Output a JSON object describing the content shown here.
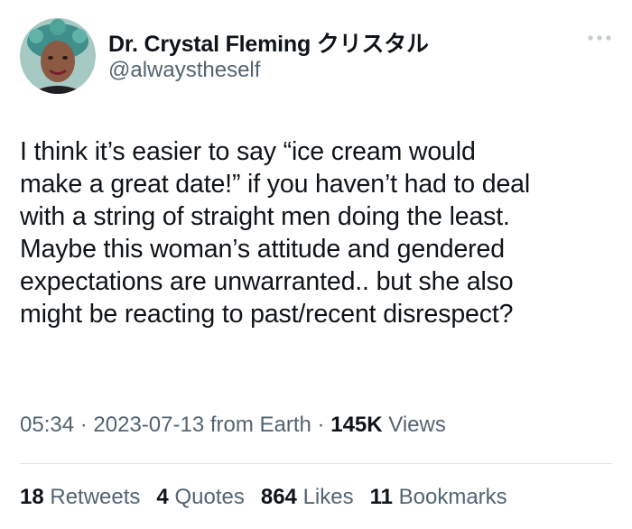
{
  "author": {
    "name": "Dr. Crystal Fleming クリスタル",
    "handle": "@alwaystheself"
  },
  "tweet": {
    "lines": [
      "I think it’s easier to say “ice cream would",
      "make a great date!” if you haven’t had to deal",
      "with a string of straight men doing the least.",
      "Maybe this woman’s attitude and gendered",
      "expectations are unwarranted.. but she also",
      "might be reacting to past/recent disrespect?"
    ]
  },
  "meta": {
    "time": "05:34",
    "separator": "·",
    "date": "2023-07-13",
    "source": "from Earth",
    "views_count": "145K",
    "views_label": "Views"
  },
  "stats": {
    "retweets_count": "18",
    "retweets_label": "Retweets",
    "quotes_count": "4",
    "quotes_label": "Quotes",
    "likes_count": "864",
    "likes_label": "Likes",
    "bookmarks_count": "11",
    "bookmarks_label": "Bookmarks"
  },
  "icons": {
    "more": "more-horizontal-icon"
  },
  "colors": {
    "text_primary": "#0f1419",
    "text_secondary": "#536471",
    "divider": "#e3e7ea"
  }
}
